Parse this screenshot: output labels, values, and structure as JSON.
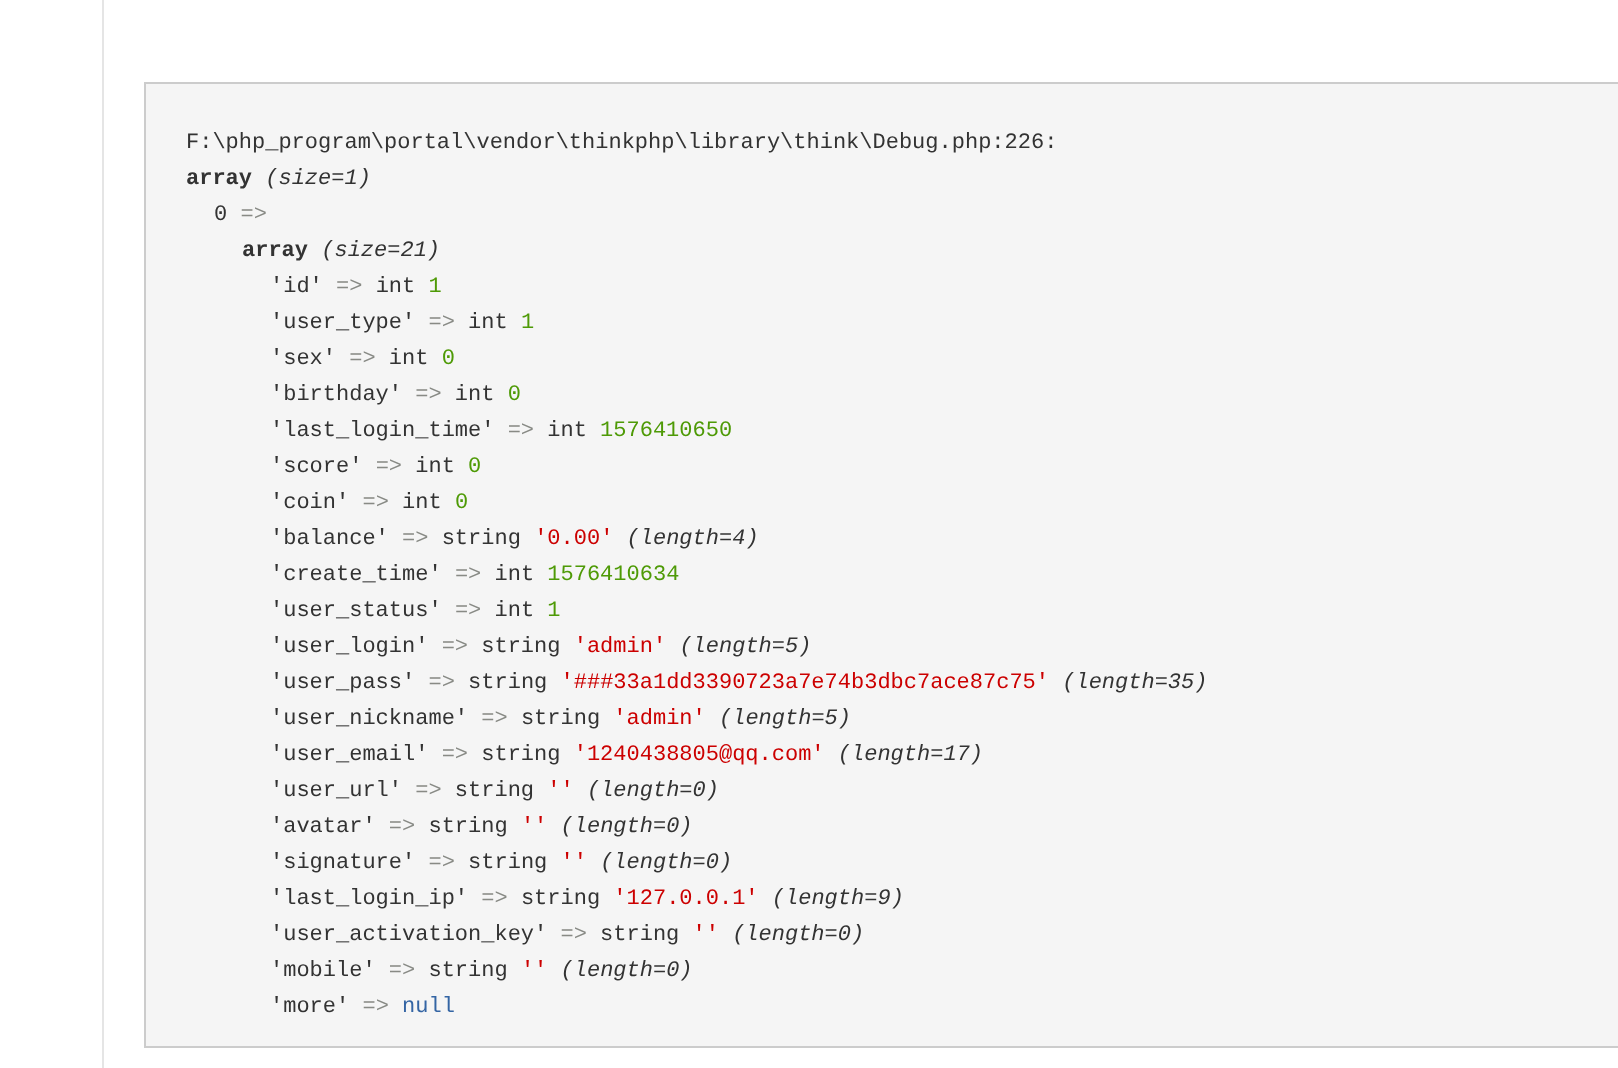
{
  "dump": {
    "location": "F:\\php_program\\portal\\vendor\\thinkphp\\library\\think\\Debug.php:226:",
    "outer": {
      "word": "array",
      "size": "(size=1)"
    },
    "index": {
      "key": "0",
      "arrow": "=>"
    },
    "inner": {
      "word": "array",
      "size": "(size=21)"
    },
    "entries": [
      {
        "kind": "int",
        "key": "'id'",
        "arrow": "=>",
        "type": "int",
        "value": "1"
      },
      {
        "kind": "int",
        "key": "'user_type'",
        "arrow": "=>",
        "type": "int",
        "value": "1"
      },
      {
        "kind": "int",
        "key": "'sex'",
        "arrow": "=>",
        "type": "int",
        "value": "0"
      },
      {
        "kind": "int",
        "key": "'birthday'",
        "arrow": "=>",
        "type": "int",
        "value": "0"
      },
      {
        "kind": "int",
        "key": "'last_login_time'",
        "arrow": "=>",
        "type": "int",
        "value": "1576410650"
      },
      {
        "kind": "int",
        "key": "'score'",
        "arrow": "=>",
        "type": "int",
        "value": "0"
      },
      {
        "kind": "int",
        "key": "'coin'",
        "arrow": "=>",
        "type": "int",
        "value": "0"
      },
      {
        "kind": "string",
        "key": "'balance'",
        "arrow": "=>",
        "type": "string",
        "value": "'0.00'",
        "length": "(length=4)"
      },
      {
        "kind": "int",
        "key": "'create_time'",
        "arrow": "=>",
        "type": "int",
        "value": "1576410634"
      },
      {
        "kind": "int",
        "key": "'user_status'",
        "arrow": "=>",
        "type": "int",
        "value": "1"
      },
      {
        "kind": "string",
        "key": "'user_login'",
        "arrow": "=>",
        "type": "string",
        "value": "'admin'",
        "length": "(length=5)"
      },
      {
        "kind": "string",
        "key": "'user_pass'",
        "arrow": "=>",
        "type": "string",
        "value": "'###33a1dd3390723a7e74b3dbc7ace87c75'",
        "length": "(length=35)"
      },
      {
        "kind": "string",
        "key": "'user_nickname'",
        "arrow": "=>",
        "type": "string",
        "value": "'admin'",
        "length": "(length=5)"
      },
      {
        "kind": "string",
        "key": "'user_email'",
        "arrow": "=>",
        "type": "string",
        "value": "'1240438805@qq.com'",
        "length": "(length=17)"
      },
      {
        "kind": "string",
        "key": "'user_url'",
        "arrow": "=>",
        "type": "string",
        "value": "''",
        "length": "(length=0)"
      },
      {
        "kind": "string",
        "key": "'avatar'",
        "arrow": "=>",
        "type": "string",
        "value": "''",
        "length": "(length=0)"
      },
      {
        "kind": "string",
        "key": "'signature'",
        "arrow": "=>",
        "type": "string",
        "value": "''",
        "length": "(length=0)"
      },
      {
        "kind": "string",
        "key": "'last_login_ip'",
        "arrow": "=>",
        "type": "string",
        "value": "'127.0.0.1'",
        "length": "(length=9)"
      },
      {
        "kind": "string",
        "key": "'user_activation_key'",
        "arrow": "=>",
        "type": "string",
        "value": "''",
        "length": "(length=0)"
      },
      {
        "kind": "string",
        "key": "'mobile'",
        "arrow": "=>",
        "type": "string",
        "value": "''",
        "length": "(length=0)"
      },
      {
        "kind": "null",
        "key": "'more'",
        "arrow": "=>",
        "value": "null"
      }
    ]
  }
}
